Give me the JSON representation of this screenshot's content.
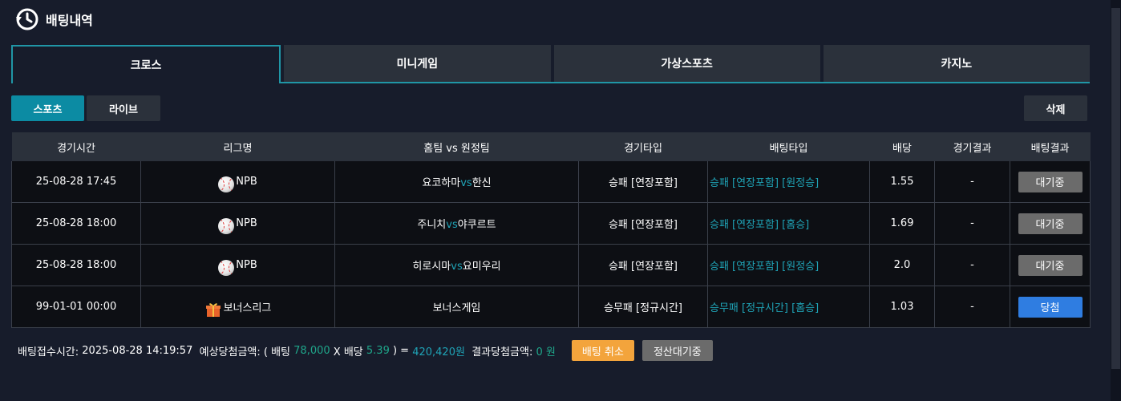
{
  "header": {
    "title": "배팅내역",
    "icon": "history-clock-icon"
  },
  "tabs": [
    "크로스",
    "미니게임",
    "가상스포츠",
    "카지노"
  ],
  "subtabs": {
    "sports": "스포츠",
    "live": "라이브",
    "delete": "삭제"
  },
  "table": {
    "headers": [
      "경기시간",
      "리그명",
      "홈팀 vs 원정팀",
      "경기타입",
      "배팅타입",
      "배당",
      "경기결과",
      "배팅결과"
    ],
    "rows": [
      {
        "time": "25-08-28 17:45",
        "league_icon": "baseball-icon",
        "league": "NPB",
        "home": "요코하마",
        "vs": "vs",
        "away": "한신",
        "game_type": "승패 [연장포함]",
        "bet_type": "승패 [연장포함] [원정승]",
        "odds": "1.55",
        "game_result": "-",
        "bet_result": "대기중"
      },
      {
        "time": "25-08-28 18:00",
        "league_icon": "baseball-icon",
        "league": "NPB",
        "home": "주니치",
        "vs": "vs",
        "away": "야쿠르트",
        "game_type": "승패 [연장포함]",
        "bet_type": "승패 [연장포함] [홈승]",
        "odds": "1.69",
        "game_result": "-",
        "bet_result": "대기중"
      },
      {
        "time": "25-08-28 18:00",
        "league_icon": "baseball-icon",
        "league": "NPB",
        "home": "히로시마",
        "vs": "vs",
        "away": "요미우리",
        "game_type": "승패 [연장포함]",
        "bet_type": "승패 [연장포함] [원정승]",
        "odds": "2.0",
        "game_result": "-",
        "bet_result": "대기중"
      },
      {
        "time": "99-01-01 00:00",
        "league_icon": "gift-box-icon",
        "league": "보너스리그",
        "home": "보너스게임",
        "vs": "",
        "away": "",
        "game_type": "승무패 [정규시간]",
        "bet_type": "승무패 [정규시간] [홈승]",
        "odds": "1.03",
        "game_result": "-",
        "bet_result": "당첨"
      }
    ]
  },
  "footer": {
    "time_label": "배팅접수시간: ",
    "time_value": "2025-08-28 14:19:57",
    "expected_label": "  예상당첨금액: ( 배팅 ",
    "bet_amount": "78,000",
    "x_label": " X 배당 ",
    "total_odds": "5.39",
    "close_label": " ) = ",
    "expected_amount": "420,420원",
    "result_label": "  결과당첨금액: ",
    "result_amount": "0 원",
    "cancel_button": "배팅 취소",
    "status_button": "정산대기중"
  },
  "colors": {
    "accent": "#2096a6",
    "background": "#171c2b",
    "win": "#2f7de1",
    "cancel": "#f3a43c",
    "pending": "#6b6b6b"
  }
}
